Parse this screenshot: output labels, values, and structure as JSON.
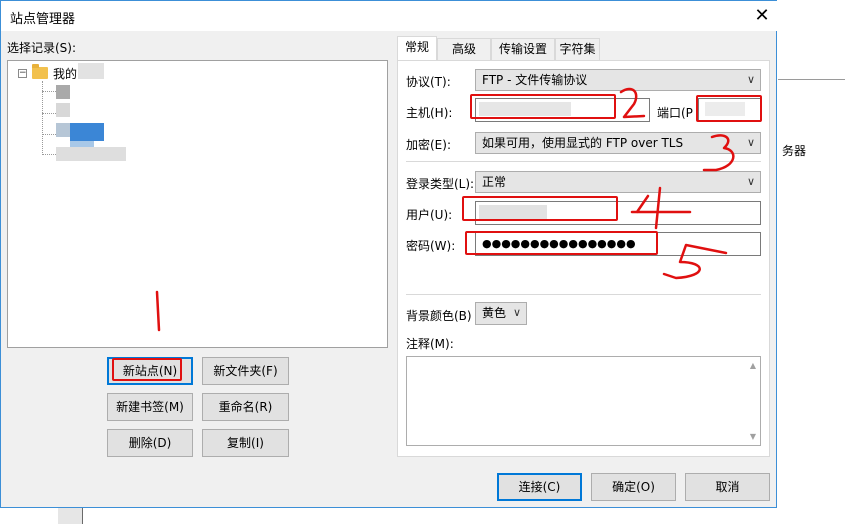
{
  "window": {
    "title": "站点管理器",
    "close_glyph": "✕"
  },
  "background": {
    "partial_text": "务器"
  },
  "tree": {
    "label": "选择记录(S):",
    "root_label": "我的",
    "expander": "−"
  },
  "buttons": {
    "new_site": "新站点(N)",
    "new_folder": "新文件夹(F)",
    "new_bookmark": "新建书签(M)",
    "rename": "重命名(R)",
    "delete": "删除(D)",
    "copy": "复制(I)",
    "connect": "连接(C)",
    "ok": "确定(O)",
    "cancel": "取消"
  },
  "tabs": [
    "常规",
    "高级",
    "传输设置",
    "字符集"
  ],
  "form": {
    "protocol_label": "协议(T):",
    "protocol_value": "FTP - 文件传输协议",
    "host_label": "主机(H):",
    "host_value": "",
    "port_label": "端口(P",
    "port_value": "",
    "encryption_label": "加密(E):",
    "encryption_value": "如果可用，使用显式的 FTP over TLS",
    "logon_type_label": "登录类型(L):",
    "logon_type_value": "正常",
    "user_label": "用户(U):",
    "user_value": "",
    "password_label": "密码(W):",
    "password_value": "●●●●●●●●●●●●●●●●",
    "bgcolor_label": "背景颜色(B)",
    "bgcolor_value": "黄色",
    "comments_label": "注释(M):"
  },
  "annotations": {
    "color": "#e01010",
    "handwritten_digits": [
      "1",
      "2",
      "3",
      "4",
      "5"
    ]
  },
  "icons": {
    "dropdown": "chevron-down-icon",
    "folder": "folder-icon",
    "close": "close-icon"
  }
}
